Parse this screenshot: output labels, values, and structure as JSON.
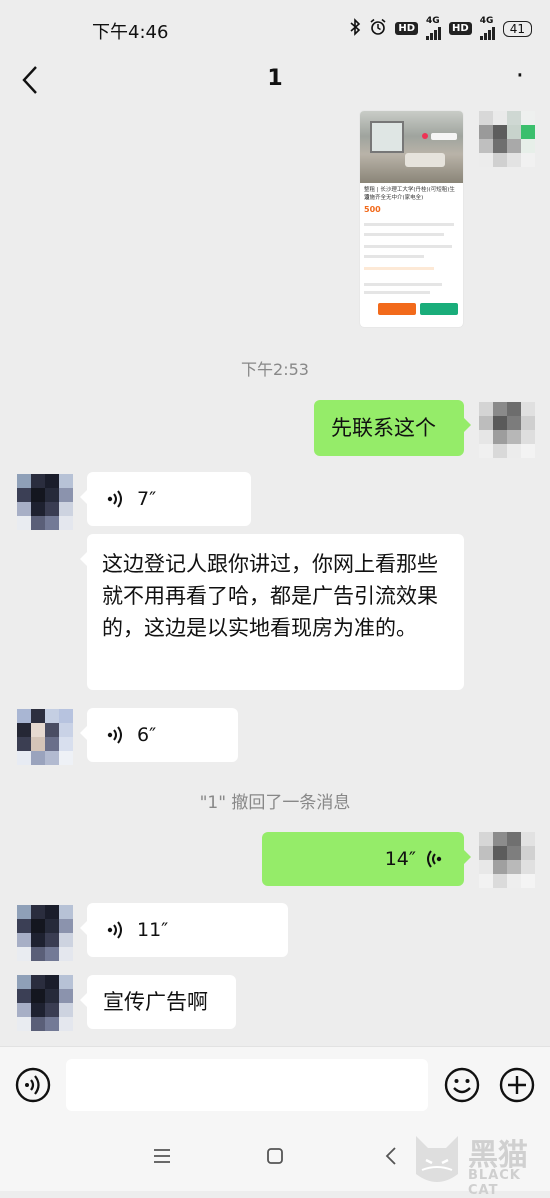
{
  "status_bar": {
    "time": "下午4:46",
    "network_a": "4G",
    "network_b": "4G",
    "hd": "HD",
    "battery": "41"
  },
  "header": {
    "title": "1",
    "more": "·"
  },
  "messages": {
    "ts1": "下午2:53",
    "m_right1": "先联系这个",
    "m_voice1": "7″",
    "m_text1": "这边登记人跟你讲过，你网上看那些就不用再看了哈，都是广告引流效果的，这边是以实地看现房为准的。",
    "m_voice2": "6″",
    "recall": "\"1\" 撤回了一条消息",
    "m_voice_right": "14″",
    "m_voice3": "11″",
    "m_text2": "宣传广告啊"
  },
  "card": {
    "title_line1": "整租 | 长沙理工大学(丹桂)(可短租)生活",
    "title_line2": "设施齐全无中介(家电全)",
    "price": "500"
  },
  "watermark": {
    "cn": "黑猫",
    "en": "BLACK CAT"
  },
  "colors": {
    "sent_bubble": "#95ec69",
    "received_bubble": "#ffffff",
    "background": "#ededed",
    "accent_orange": "#f26a1b",
    "accent_green": "#1aad7a"
  }
}
